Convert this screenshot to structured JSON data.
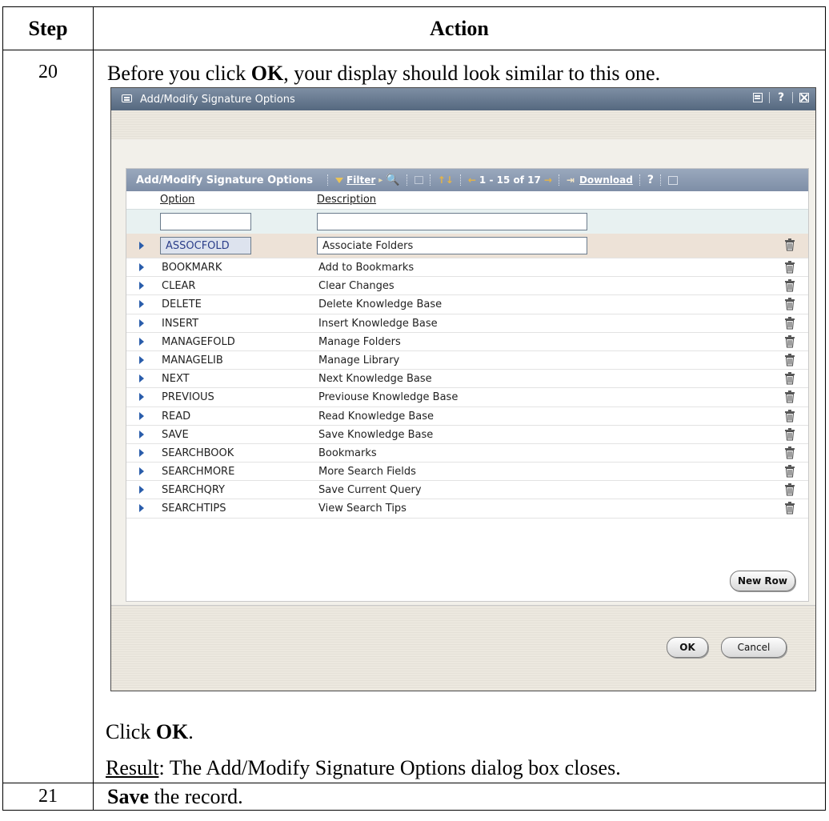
{
  "table": {
    "header_step": "Step",
    "header_action": "Action",
    "row20": {
      "step": "20",
      "instruction_pre": "Before you click ",
      "instruction_bold": "OK",
      "instruction_post": ", your display should look similar to this one.",
      "click_pre": "Click ",
      "click_bold": "OK",
      "click_post": ".",
      "result_label": "Result",
      "result_text": ": The Add/Modify Signature Options dialog box closes."
    },
    "row21": {
      "step": "21",
      "bold": "Save",
      "text": " the record."
    }
  },
  "dialog": {
    "title": "Add/Modify Signature Options",
    "help": "?",
    "grid": {
      "title": "Add/Modify Signature Options",
      "filter_label": "Filter",
      "pager": "1 - 15 of 17",
      "download_label": "Download",
      "help": "?",
      "col_option": "Option",
      "col_description": "Description",
      "rows": [
        {
          "option": "ASSOCFOLD",
          "description": "Associate Folders"
        },
        {
          "option": "BOOKMARK",
          "description": "Add to Bookmarks"
        },
        {
          "option": "CLEAR",
          "description": "Clear Changes"
        },
        {
          "option": "DELETE",
          "description": "Delete Knowledge Base"
        },
        {
          "option": "INSERT",
          "description": "Insert Knowledge Base"
        },
        {
          "option": "MANAGEFOLD",
          "description": "Manage Folders"
        },
        {
          "option": "MANAGELIB",
          "description": "Manage Library"
        },
        {
          "option": "NEXT",
          "description": "Next Knowledge Base"
        },
        {
          "option": "PREVIOUS",
          "description": "Previouse Knowledge Base"
        },
        {
          "option": "READ",
          "description": "Read Knowledge Base"
        },
        {
          "option": "SAVE",
          "description": "Save Knowledge Base"
        },
        {
          "option": "SEARCHBOOK",
          "description": "Bookmarks"
        },
        {
          "option": "SEARCHMORE",
          "description": "More Search Fields"
        },
        {
          "option": "SEARCHQRY",
          "description": "Save Current Query"
        },
        {
          "option": "SEARCHTIPS",
          "description": "View Search Tips"
        }
      ],
      "new_row_label": "New Row"
    },
    "ok_label": "OK",
    "cancel_label": "Cancel"
  },
  "colors": {
    "titlebar": "#55687f",
    "grid_toolbar": "#8594ab",
    "selected_row": "#ede2d7",
    "filter_row": "#e8f1f1",
    "row_pointer": "#2a5dab"
  }
}
